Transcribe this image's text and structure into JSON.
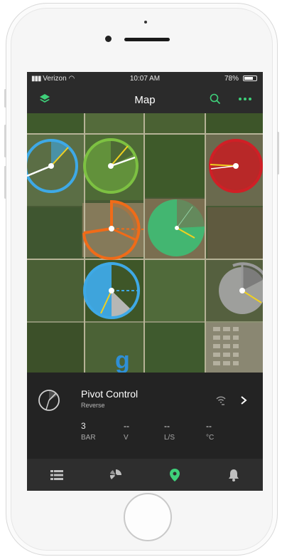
{
  "status_bar": {
    "carrier": "Verizon",
    "time": "10:07 AM",
    "battery": "78%",
    "battery_level": 0.78
  },
  "nav": {
    "title": "Map",
    "left_icon": "layers-icon",
    "right_icons": [
      "search-icon",
      "more-icon"
    ]
  },
  "colors": {
    "accent": "#3fd07a",
    "nav_bg": "#2b2b2b",
    "panel_bg": "#232323",
    "tab_bg": "#2e2e2e",
    "pivot_blue": "#3ea9e6",
    "pivot_lime": "#7dc142",
    "pivot_red": "#d01f26",
    "pivot_orange": "#f06b18",
    "pivot_green": "#3dbe74",
    "pivot_gray": "#9a9a9a"
  },
  "map": {
    "pivots": [
      {
        "name": "pivot-blue-top",
        "color": "blue",
        "type": "full-ring"
      },
      {
        "name": "pivot-lime",
        "color": "lime",
        "type": "full-ring"
      },
      {
        "name": "pivot-red",
        "color": "red",
        "type": "full-ring"
      },
      {
        "name": "pivot-orange",
        "color": "orange",
        "type": "partial-sector"
      },
      {
        "name": "pivot-green",
        "color": "green",
        "type": "filled-sector"
      },
      {
        "name": "pivot-blue-mid",
        "color": "blue",
        "type": "full-ring"
      },
      {
        "name": "pivot-gray",
        "color": "gray",
        "type": "partial-ring"
      }
    ]
  },
  "panel": {
    "title": "Pivot Control",
    "subtitle": "Reverse",
    "metrics": [
      {
        "value": "3",
        "unit": "BAR"
      },
      {
        "value": "--",
        "unit": "V"
      },
      {
        "value": "--",
        "unit": "L/S"
      },
      {
        "value": "--",
        "unit": "°C"
      }
    ],
    "icons": [
      "pivot-status-icon",
      "signal-icon",
      "chevron-right-icon"
    ]
  },
  "tabs": [
    {
      "name": "list",
      "icon": "list-icon",
      "active": false
    },
    {
      "name": "pivot",
      "icon": "pivot-icon",
      "active": false
    },
    {
      "name": "map",
      "icon": "map-pin-icon",
      "active": true
    },
    {
      "name": "alerts",
      "icon": "bell-icon",
      "active": false
    }
  ]
}
